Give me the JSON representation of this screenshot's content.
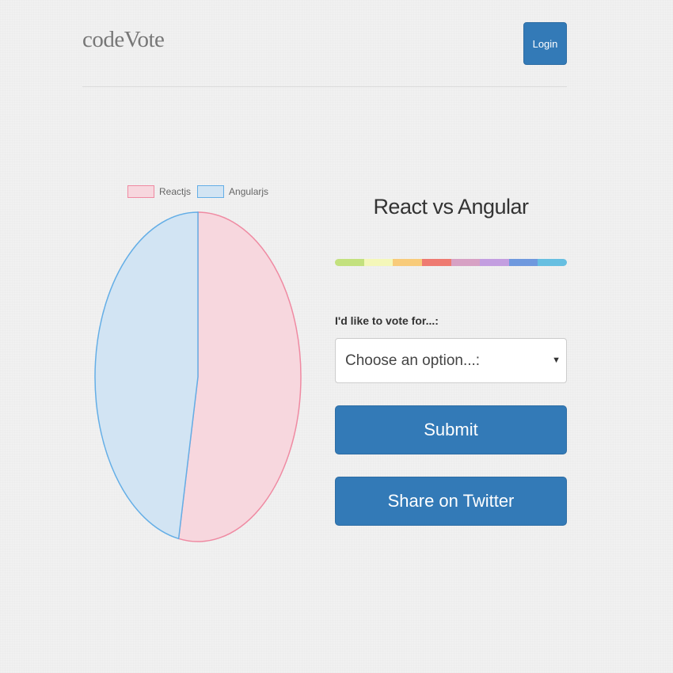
{
  "header": {
    "brand": "codeVote",
    "login_label": "Login"
  },
  "poll": {
    "title": "React vs Angular",
    "vote_label": "I'd like to vote for...:",
    "select_placeholder": "Choose an option...:",
    "submit_label": "Submit",
    "share_label": "Share on Twitter",
    "rainbow_colors": [
      "#c3e17e",
      "#f4f7b9",
      "#f8cb7a",
      "#ee7a71",
      "#d7a1c4",
      "#c39ee0",
      "#6f99de",
      "#67bfe1"
    ]
  },
  "chart_data": {
    "type": "pie",
    "categories": [
      "Reactjs",
      "Angularjs"
    ],
    "values": [
      53,
      47
    ],
    "colors": {
      "fill": [
        "#f7d7de",
        "#d2e4f3"
      ],
      "stroke": [
        "#ef8aa2",
        "#64aee6"
      ]
    },
    "legend": "top"
  }
}
